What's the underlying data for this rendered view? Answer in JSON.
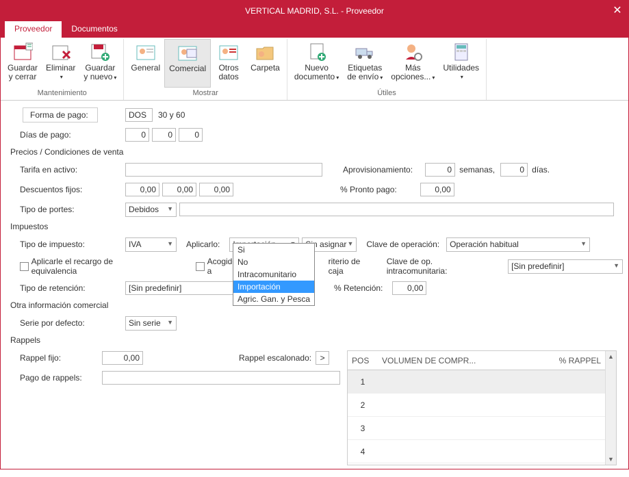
{
  "title": "VERTICAL MADRID, S.L. - Proveedor",
  "tabs": {
    "t0": "Proveedor",
    "t1": "Documentos"
  },
  "ribbon": {
    "g1": {
      "label": "Mantenimiento",
      "b1": {
        "l1": "Guardar",
        "l2": "y cerrar"
      },
      "b2": {
        "l1": "Eliminar",
        "l2": ""
      },
      "b3": {
        "l1": "Guardar",
        "l2": "y nuevo"
      }
    },
    "g2": {
      "label": "Mostrar",
      "b1": "General",
      "b2": "Comercial",
      "b3": {
        "l1": "Otros",
        "l2": "datos"
      },
      "b4": "Carpeta"
    },
    "g3": {
      "label": "Útiles",
      "b1": {
        "l1": "Nuevo",
        "l2": "documento"
      },
      "b2": {
        "l1": "Etiquetas",
        "l2": "de envío"
      },
      "b3": {
        "l1": "Más",
        "l2": "opciones..."
      },
      "b4": "Utilidades"
    }
  },
  "forma_pago": {
    "label": "Forma de pago:",
    "code": "DOS",
    "text": "30 y 60"
  },
  "dias_pago": {
    "label": "Días de pago:",
    "v1": "0",
    "v2": "0",
    "v3": "0"
  },
  "sec_precios": "Precios / Condiciones de venta",
  "tarifa": {
    "label": "Tarifa en activo:",
    "value": ""
  },
  "aprov": {
    "label": "Aprovisionamiento:",
    "v": "0",
    "w": "semanas,",
    "d": "0",
    "dl": "días."
  },
  "desc": {
    "label": "Descuentos fijos:",
    "v1": "0,00",
    "v2": "0,00",
    "v3": "0,00"
  },
  "pronto": {
    "label": "% Pronto pago:",
    "v": "0,00"
  },
  "portes": {
    "label": "Tipo de portes:",
    "v": "Debidos"
  },
  "sec_imp": "Impuestos",
  "tipo_imp": {
    "label": "Tipo de impuesto:",
    "v": "IVA"
  },
  "aplicarlo": {
    "label": "Aplicarlo:",
    "v": "Importación"
  },
  "sin_asignar": "Sin asignar",
  "clave_op": {
    "label": "Clave de operación:",
    "v": "Operación habitual"
  },
  "recargo": "Aplicarle el recargo de equivalencia",
  "acogido_pre": "Acogido a",
  "acogido_post": "riterio de caja",
  "clave_intra": {
    "label": "Clave de op. intracomunitaria:",
    "v": "[Sin predefinir]"
  },
  "tipo_ret": {
    "label": "Tipo de retención:",
    "v": "[Sin predefinir]"
  },
  "pct_ret": {
    "label": "% Retención:",
    "v": "0,00"
  },
  "dd": {
    "o1": "Si",
    "o2": "No",
    "o3": "Intracomunitario",
    "o4": "Importación",
    "o5": "Agric. Gan. y Pesca"
  },
  "sec_otra": "Otra información comercial",
  "serie": {
    "label": "Serie por defecto:",
    "v": "Sin serie"
  },
  "sec_rappels": "Rappels",
  "rappel_fijo": {
    "label": "Rappel fijo:",
    "v": "0,00"
  },
  "rappel_esc": "Rappel escalonado:",
  "pago_rappels": "Pago de rappels:",
  "gt": ">",
  "table": {
    "h1": "POS",
    "h2": "VOLUMEN DE COMPR...",
    "h3": "% RAPPEL",
    "r1": "1",
    "r2": "2",
    "r3": "3",
    "r4": "4"
  }
}
